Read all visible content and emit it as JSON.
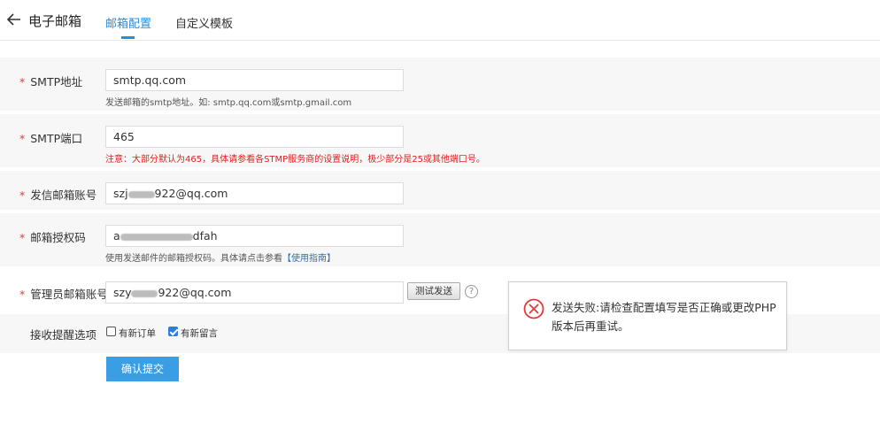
{
  "header": {
    "title": "电子邮箱",
    "tabs": [
      "邮箱配置",
      "自定义模板"
    ]
  },
  "form": {
    "smtp_address": {
      "label": "SMTP地址",
      "value": "smtp.qq.com",
      "help": "发送邮箱的smtp地址。如: smtp.qq.com或smtp.gmail.com"
    },
    "smtp_port": {
      "label": "SMTP端口",
      "value": "465",
      "help": "注意：大部分默认为465，具体请参看各STMP服务商的设置说明，极少部分是25或其他端口号。"
    },
    "sender_account": {
      "label": "发信邮箱账号",
      "value_prefix": "szj",
      "value_suffix": "922@qq.com"
    },
    "auth_code": {
      "label": "邮箱授权码",
      "value_prefix": "a",
      "value_suffix": "dfah",
      "help_prefix": "使用发送邮件的邮箱授权码。具体请点击参看",
      "help_link": "【使用指南】"
    },
    "admin_account": {
      "label": "管理员邮箱账号",
      "value_prefix": "szy",
      "value_suffix": "922@qq.com",
      "test_button": "测试发送"
    },
    "notify": {
      "label": "接收提醒选项",
      "options": [
        {
          "label": "有新订单",
          "checked": false
        },
        {
          "label": "有新留言",
          "checked": true
        }
      ]
    },
    "submit": "确认提交",
    "required_mark": "*",
    "help_icon": "?"
  },
  "popup": {
    "message": "发送失败:请检查配置填写是否正确或更改PHP版本后再重试。",
    "icon": "error-circle-icon"
  },
  "colors": {
    "accent": "#2d8cd8",
    "error": "#e02020",
    "button": "#3a9ee4"
  }
}
